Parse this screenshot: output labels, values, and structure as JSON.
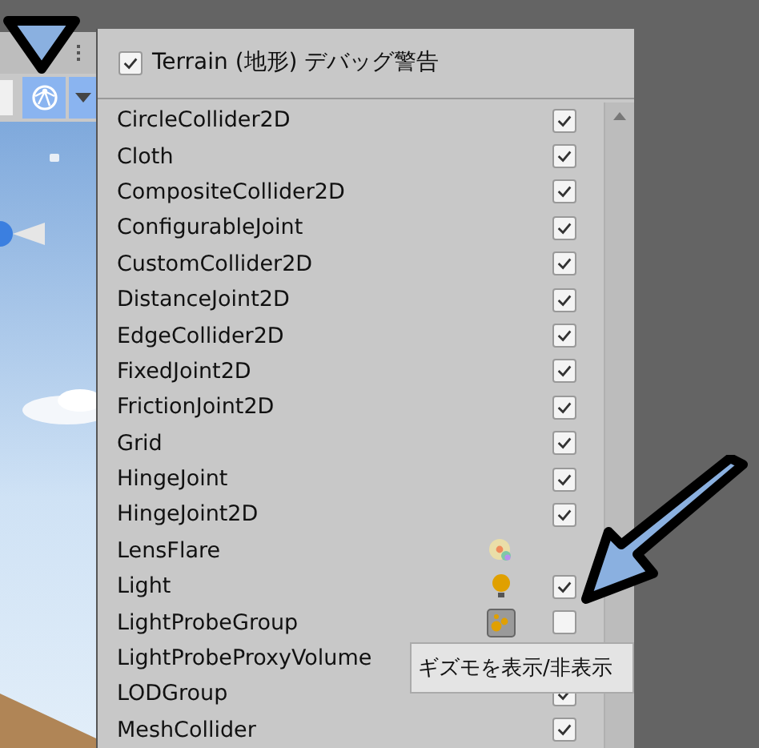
{
  "header_options": [
    {
      "label": "Terrain (地形) デバッグ警告",
      "checked": true
    }
  ],
  "gizmo_rows": [
    {
      "name": "CircleCollider2D",
      "checked": true
    },
    {
      "name": "Cloth",
      "checked": true
    },
    {
      "name": "CompositeCollider2D",
      "checked": true
    },
    {
      "name": "ConfigurableJoint",
      "checked": true
    },
    {
      "name": "CustomCollider2D",
      "checked": true
    },
    {
      "name": "DistanceJoint2D",
      "checked": true
    },
    {
      "name": "EdgeCollider2D",
      "checked": true
    },
    {
      "name": "FixedJoint2D",
      "checked": true
    },
    {
      "name": "FrictionJoint2D",
      "checked": true
    },
    {
      "name": "Grid",
      "checked": true
    },
    {
      "name": "HingeJoint",
      "checked": true
    },
    {
      "name": "HingeJoint2D",
      "checked": true
    },
    {
      "name": "LensFlare",
      "kind": "flare"
    },
    {
      "name": "Light",
      "kind": "bulb",
      "checked": true
    },
    {
      "name": "LightProbeGroup",
      "kind": "probes",
      "checked": false
    },
    {
      "name": "LightProbeProxyVolume"
    },
    {
      "name": "LODGroup",
      "checked": true
    },
    {
      "name": "MeshCollider",
      "checked": true
    }
  ],
  "tooltip": "ギズモを表示/非表示",
  "toolbar": {
    "gizmo_button": {
      "selected": true
    }
  }
}
